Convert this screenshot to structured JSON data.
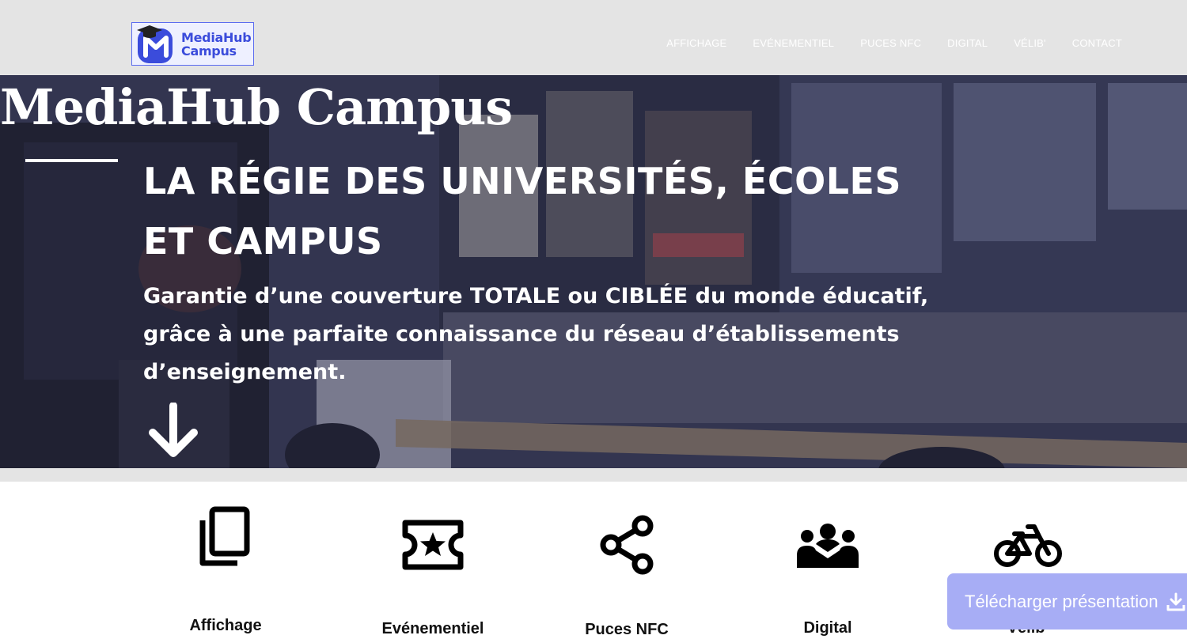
{
  "header": {
    "logo_line1": "MediaHub",
    "logo_line2": "Campus",
    "nav": [
      {
        "label": "AFFICHAGE"
      },
      {
        "label": "EVÉNEMENTIEL"
      },
      {
        "label": "PUCES NFC"
      },
      {
        "label": "DIGITAL"
      },
      {
        "label": "VÉLIB'"
      },
      {
        "label": "CONTACT"
      }
    ]
  },
  "hero": {
    "brand": "MediaHub Campus",
    "tagline": "LA RÉGIE DES UNIVERSITÉS, ÉCOLES ET CAMPUS",
    "description": "Garantie d’une couverture TOTALE ou CIBLÉE du monde éducatif, grâce à une parfaite connaissance du réseau d’établissements d’enseignement.",
    "scroll_icon": "arrow-down-icon"
  },
  "features": [
    {
      "label": "Affichage",
      "icon": "copy-icon"
    },
    {
      "label": "Evénementiel",
      "icon": "ticket-star-icon"
    },
    {
      "label": "Puces NFC",
      "icon": "share-icon"
    },
    {
      "label": "Digital",
      "icon": "group-icon"
    },
    {
      "label": "Vélib'",
      "icon": "bicycle-icon"
    }
  ],
  "cta": {
    "download_label": "Télécharger présentation",
    "icon": "download-icon"
  },
  "colors": {
    "brand": "#3b4cdb",
    "cta": "#a7adf5",
    "header_bg": "#e4e4e4"
  }
}
